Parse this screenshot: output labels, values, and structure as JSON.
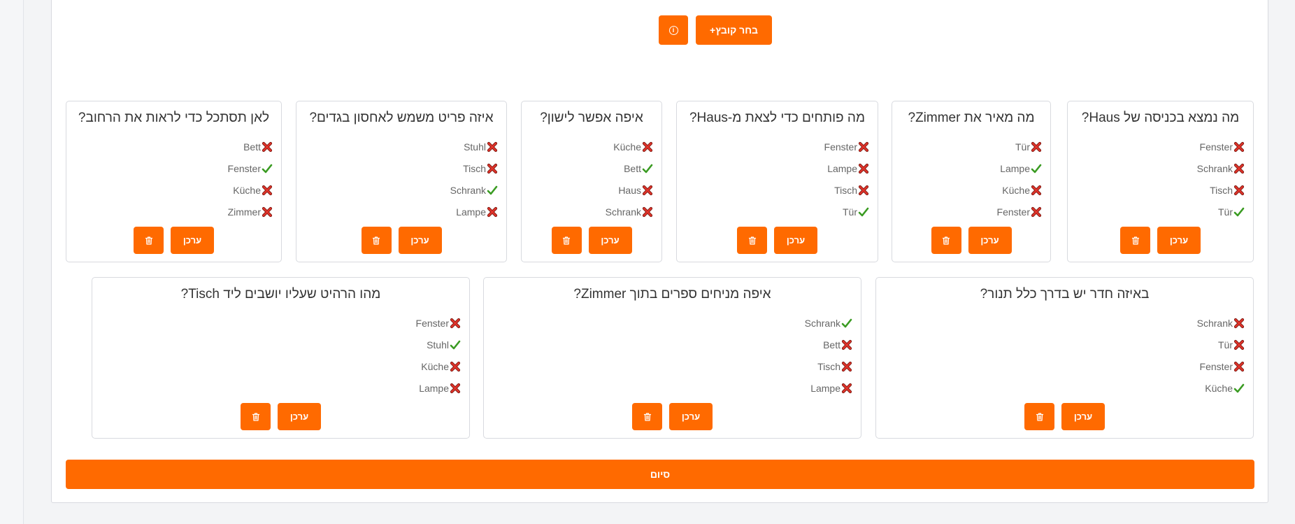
{
  "toolbar": {
    "info_icon": "info-circle-icon",
    "choose_file_label": "+בחר קובץ"
  },
  "cards": [
    {
      "title": "מה נמצא בכניסה של Haus?",
      "answers": [
        {
          "text": "Fenster",
          "correct": false
        },
        {
          "text": "Schrank",
          "correct": false
        },
        {
          "text": "Tisch",
          "correct": false
        },
        {
          "text": "Tür",
          "correct": true
        }
      ]
    },
    {
      "title": "מה מאיר את Zimmer?",
      "answers": [
        {
          "text": "Tür",
          "correct": false
        },
        {
          "text": "Lampe",
          "correct": true
        },
        {
          "text": "Küche",
          "correct": false
        },
        {
          "text": "Fenster",
          "correct": false
        }
      ]
    },
    {
      "title": "מה פותחים כדי לצאת מ-Haus?",
      "answers": [
        {
          "text": "Fenster",
          "correct": false
        },
        {
          "text": "Lampe",
          "correct": false
        },
        {
          "text": "Tisch",
          "correct": false
        },
        {
          "text": "Tür",
          "correct": true
        }
      ]
    },
    {
      "title": "איפה אפשר לישון?",
      "answers": [
        {
          "text": "Küche",
          "correct": false
        },
        {
          "text": "Bett",
          "correct": true
        },
        {
          "text": "Haus",
          "correct": false
        },
        {
          "text": "Schrank",
          "correct": false
        }
      ]
    },
    {
      "title": "איזה פריט משמש לאחסון בגדים?",
      "answers": [
        {
          "text": "Stuhl",
          "correct": false
        },
        {
          "text": "Tisch",
          "correct": false
        },
        {
          "text": "Schrank",
          "correct": true
        },
        {
          "text": "Lampe",
          "correct": false
        }
      ]
    },
    {
      "title": "לאן תסתכל כדי לראות את הרחוב?",
      "answers": [
        {
          "text": "Bett",
          "correct": false
        },
        {
          "text": "Fenster",
          "correct": true
        },
        {
          "text": "Küche",
          "correct": false
        },
        {
          "text": "Zimmer",
          "correct": false
        }
      ]
    },
    {
      "title": "באיזה חדר יש בדרך כלל תנור?",
      "answers": [
        {
          "text": "Schrank",
          "correct": false
        },
        {
          "text": "Tür",
          "correct": false
        },
        {
          "text": "Fenster",
          "correct": false
        },
        {
          "text": "Küche",
          "correct": true
        }
      ]
    },
    {
      "title": "איפה מניחים ספרים בתוך Zimmer?",
      "answers": [
        {
          "text": "Schrank",
          "correct": true
        },
        {
          "text": "Bett",
          "correct": false
        },
        {
          "text": "Tisch",
          "correct": false
        },
        {
          "text": "Lampe",
          "correct": false
        }
      ]
    },
    {
      "title": "מהו הרהיט שעליו יושבים ליד Tisch?",
      "answers": [
        {
          "text": "Fenster",
          "correct": false
        },
        {
          "text": "Stuhl",
          "correct": true
        },
        {
          "text": "Küche",
          "correct": false
        },
        {
          "text": "Lampe",
          "correct": false
        }
      ]
    }
  ],
  "labels": {
    "edit": "ערכן",
    "finish": "סיום"
  },
  "colors": {
    "accent": "#ff6a00",
    "correct": "#3a9b22",
    "wrong": "#cc2a1f"
  }
}
